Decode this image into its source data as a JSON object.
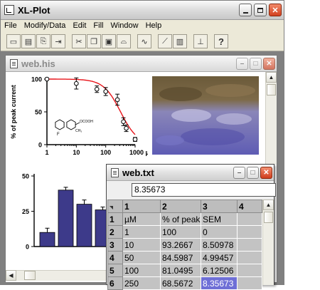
{
  "app": {
    "title": "XL-Plot",
    "menu": [
      "File",
      "Modify/Data",
      "Edit",
      "Fill",
      "Window",
      "Help"
    ],
    "toolbar_icons": [
      "new-doc-icon",
      "open-doc-icon",
      "paste-special-icon",
      "export-icon",
      "cut-icon",
      "copy-icon",
      "paste-icon",
      "link-icon",
      "curve-fit-icon",
      "line-plot-icon",
      "bar-plot-icon",
      "error-bar-icon",
      "help-icon"
    ]
  },
  "his_window": {
    "title": "web.his",
    "structure_label": "F",
    "structure_group": "OCOOH",
    "structure_methyl": "CH₃",
    "colors": {
      "curve": "#e8141a",
      "bars": "#3d3a8a",
      "photo": "#6a68b8"
    }
  },
  "chart_data": [
    {
      "type": "scatter",
      "title": "",
      "xlabel": "",
      "ylabel": "% of peak current",
      "x_scale": "log",
      "xlim": [
        1,
        1000
      ],
      "ylim": [
        0,
        100
      ],
      "x_tick_labels": [
        "1",
        "10",
        "100",
        "1000 µM"
      ],
      "y_tick_labels": [
        "0",
        "50",
        "100"
      ],
      "series": [
        {
          "x": [
            1,
            10,
            50,
            100,
            250,
            400,
            500,
            1000
          ],
          "y": [
            100,
            93.3,
            84.6,
            81.0,
            68.6,
            35,
            25,
            8
          ],
          "err": [
            0,
            8.5,
            5.0,
            6.1,
            8.4,
            6,
            5,
            3
          ]
        }
      ],
      "fit_curve": {
        "top": 100,
        "ic50": 320,
        "hill": 1.5
      }
    },
    {
      "type": "bar",
      "title": "",
      "ylabel": "",
      "ylim": [
        0,
        50
      ],
      "y_tick_labels": [
        "0",
        "25",
        "50"
      ],
      "values": [
        10,
        40,
        30,
        26
      ],
      "err": [
        3,
        2,
        3,
        2
      ]
    }
  ],
  "sheet_window": {
    "title": "web.txt",
    "formula_value": "8.35673",
    "column_headers": [
      "1",
      "2",
      "3",
      "4"
    ],
    "rows": [
      {
        "num": "1",
        "cells": [
          "µM",
          "% of peak",
          "SEM",
          ""
        ]
      },
      {
        "num": "2",
        "cells": [
          "1",
          "100",
          "0",
          ""
        ]
      },
      {
        "num": "3",
        "cells": [
          "10",
          "93.2667",
          "8.50978",
          ""
        ]
      },
      {
        "num": "4",
        "cells": [
          "50",
          "84.5987",
          "4.99457",
          ""
        ]
      },
      {
        "num": "5",
        "cells": [
          "100",
          "81.0495",
          "6.12506",
          ""
        ]
      },
      {
        "num": "6",
        "cells": [
          "250",
          "68.5672",
          "8.35673",
          ""
        ]
      }
    ],
    "selected_cell": {
      "row": 5,
      "col": 2
    }
  }
}
